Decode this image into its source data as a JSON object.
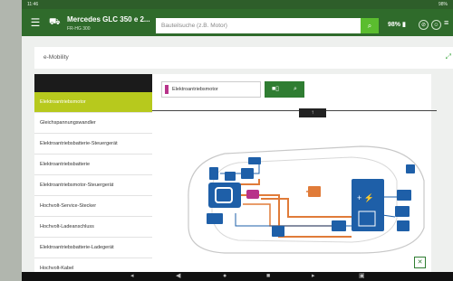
{
  "statusbar": {
    "left": "11:46",
    "right": "98%"
  },
  "appbar": {
    "vehicle_title": "Mercedes GLC 350 e 2...",
    "plate": "FR-HG 300",
    "search_placeholder": "Bauteilsuche (z.B. Motor)",
    "battery": "98%"
  },
  "breadcrumb": {
    "title": "e-Mobility"
  },
  "sidebar": {
    "items": [
      {
        "label": "Elektroantriebsmotor"
      },
      {
        "label": "Gleichspannungswandler"
      },
      {
        "label": "Elektroantriebsbatterie-Steuergerät"
      },
      {
        "label": "Elektroantriebsbatterie"
      },
      {
        "label": "Elektroantriebsmotor-Steuergerät"
      },
      {
        "label": "Hochvolt-Service-Stecker"
      },
      {
        "label": "Hochvolt-Ladeanschluss"
      },
      {
        "label": "Elektroantriebsbatterie-Ladegerät"
      },
      {
        "label": "Hochvolt-Kabel"
      }
    ]
  },
  "main": {
    "component_title": "Elektroantriebsmotor"
  },
  "colors": {
    "brand": "#2f6b2b",
    "accent": "#5bbd2f",
    "active": "#b7c91d",
    "highlight": "#b8338a",
    "wire": "#e07b39",
    "module": "#1e5fa8"
  }
}
